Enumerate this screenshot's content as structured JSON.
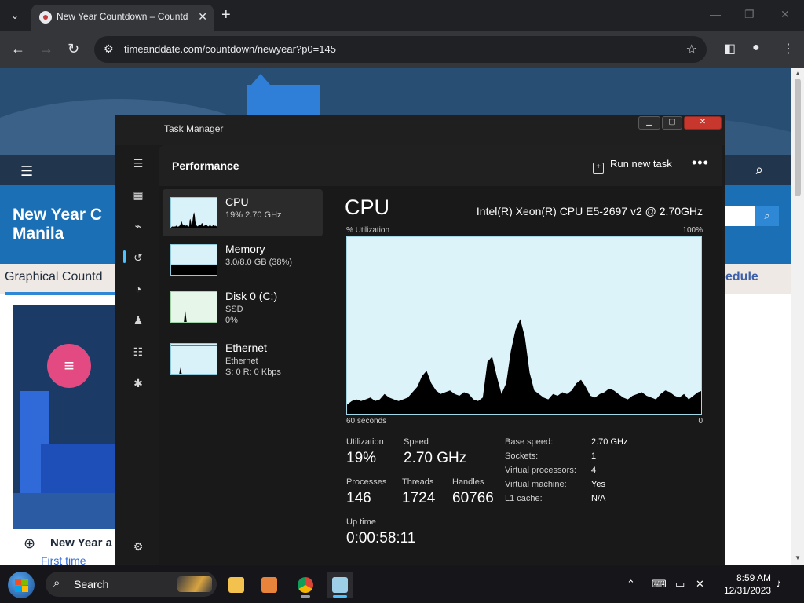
{
  "browser": {
    "tab_title": "New Year Countdown – Countd",
    "tab_close": "✕",
    "new_tab": "+",
    "url": "timeanddate.com/countdown/newyear?p0=145",
    "min": "—",
    "max": "❐",
    "close": "✕"
  },
  "page": {
    "heading": "New Year C\nManila",
    "subheading": "Graphical Countd",
    "subheading_right": "edule",
    "ny_line": "New Year a",
    "first_time": "First time"
  },
  "taskmanager": {
    "window_title": "Task Manager",
    "header": "Performance",
    "run_new_task": "Run new task",
    "more": "•••",
    "sidebar": [
      {
        "name": "CPU",
        "sub1": "19%  2.70 GHz",
        "sub2": ""
      },
      {
        "name": "Memory",
        "sub1": "3.0/8.0 GB (38%)",
        "sub2": ""
      },
      {
        "name": "Disk 0 (C:)",
        "sub1": "SSD",
        "sub2": "0%"
      },
      {
        "name": "Ethernet",
        "sub1": "Ethernet",
        "sub2": "S: 0  R: 0 Kbps"
      }
    ],
    "cpu": {
      "title": "CPU",
      "model": "Intel(R) Xeon(R) CPU E5-2697 v2 @ 2.70GHz",
      "util_label": "% Utilization",
      "util_max": "100%",
      "time_left": "60 seconds",
      "time_right": "0",
      "graph_values": [
        6,
        8,
        9,
        8,
        9,
        10,
        8,
        9,
        12,
        10,
        9,
        8,
        9,
        10,
        13,
        16,
        22,
        25,
        18,
        14,
        12,
        13,
        14,
        12,
        11,
        13,
        12,
        9,
        8,
        10,
        30,
        33,
        22,
        12,
        18,
        36,
        48,
        54,
        44,
        24,
        14,
        12,
        10,
        9,
        12,
        11,
        13,
        12,
        14,
        18,
        20,
        16,
        11,
        10,
        12,
        13,
        15,
        14,
        12,
        10,
        9,
        11,
        12,
        13,
        11,
        10,
        9,
        12,
        14,
        13,
        11,
        10,
        12,
        9,
        11,
        13,
        14
      ],
      "stats": {
        "utilization_label": "Utilization",
        "utilization": "19%",
        "speed_label": "Speed",
        "speed": "2.70 GHz",
        "processes_label": "Processes",
        "processes": "146",
        "threads_label": "Threads",
        "threads": "1724",
        "handles_label": "Handles",
        "handles": "60766",
        "uptime_label": "Up time",
        "uptime": "0:00:58:11"
      },
      "details": [
        {
          "k": "Base speed:",
          "v": "2.70 GHz"
        },
        {
          "k": "Sockets:",
          "v": "1"
        },
        {
          "k": "Virtual processors:",
          "v": "4"
        },
        {
          "k": "Virtual machine:",
          "v": "Yes"
        },
        {
          "k": "L1 cache:",
          "v": "N/A"
        }
      ]
    }
  },
  "taskbar": {
    "search_label": "Search",
    "time": "8:59 AM",
    "date": "12/31/2023"
  },
  "colors": {
    "graph_fill": "#000000",
    "graph_bg": "#dcf3fa",
    "accent": "#4cc2ff"
  }
}
